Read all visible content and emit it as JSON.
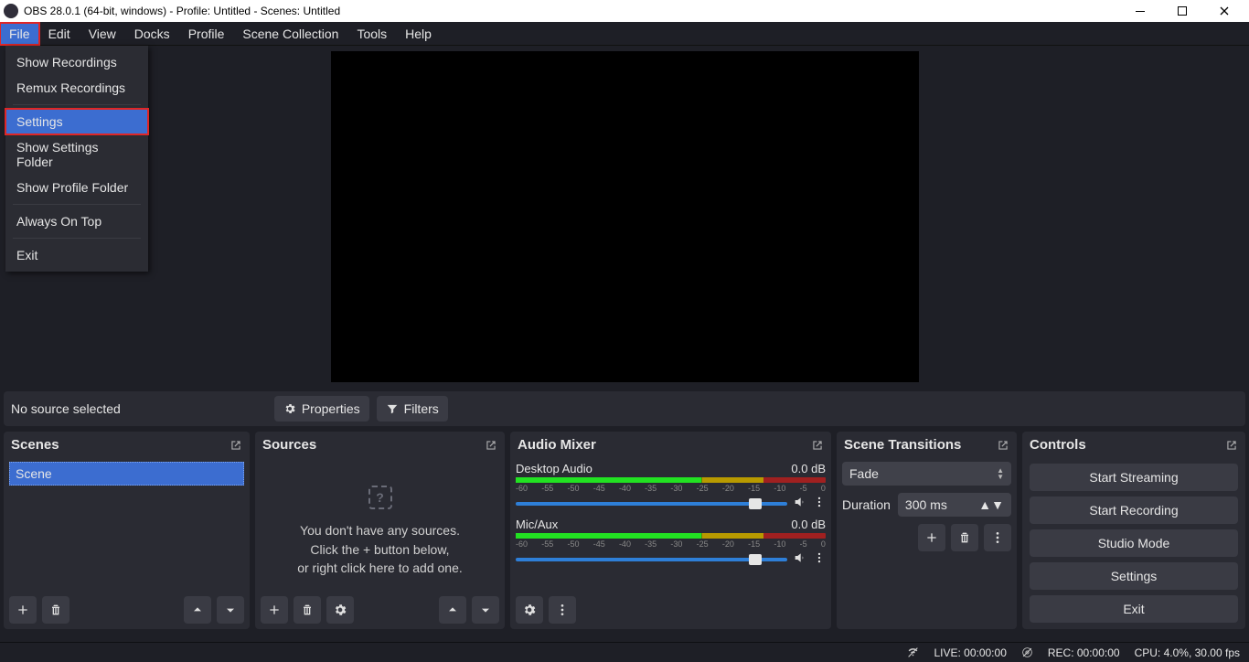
{
  "titlebar": {
    "title": "OBS 28.0.1 (64-bit, windows) - Profile: Untitled - Scenes: Untitled"
  },
  "menubar": {
    "items": [
      "File",
      "Edit",
      "View",
      "Docks",
      "Profile",
      "Scene Collection",
      "Tools",
      "Help"
    ]
  },
  "file_menu": {
    "show_recordings": "Show Recordings",
    "remux_recordings": "Remux Recordings",
    "settings": "Settings",
    "show_settings_folder": "Show Settings Folder",
    "show_profile_folder": "Show Profile Folder",
    "always_on_top": "Always On Top",
    "exit": "Exit"
  },
  "context_toolbar": {
    "no_source": "No source selected",
    "properties": "Properties",
    "filters": "Filters"
  },
  "docks": {
    "scenes_title": "Scenes",
    "sources_title": "Sources",
    "mixer_title": "Audio Mixer",
    "transitions_title": "Scene Transitions",
    "controls_title": "Controls"
  },
  "scenes": {
    "items": [
      "Scene"
    ]
  },
  "sources_empty": {
    "line1": "You don't have any sources.",
    "line2": "Click the + button below,",
    "line3": "or right click here to add one."
  },
  "mixer": {
    "channels": [
      {
        "name": "Desktop Audio",
        "db": "0.0 dB"
      },
      {
        "name": "Mic/Aux",
        "db": "0.0 dB"
      }
    ],
    "scale": [
      "-60",
      "-55",
      "-50",
      "-45",
      "-40",
      "-35",
      "-30",
      "-25",
      "-20",
      "-15",
      "-10",
      "-5",
      "0"
    ]
  },
  "transitions": {
    "current": "Fade",
    "duration_label": "Duration",
    "duration_value": "300 ms"
  },
  "controls": {
    "start_streaming": "Start Streaming",
    "start_recording": "Start Recording",
    "studio_mode": "Studio Mode",
    "settings": "Settings",
    "exit": "Exit"
  },
  "statusbar": {
    "live": "LIVE: 00:00:00",
    "rec": "REC: 00:00:00",
    "cpu": "CPU: 4.0%, 30.00 fps"
  }
}
